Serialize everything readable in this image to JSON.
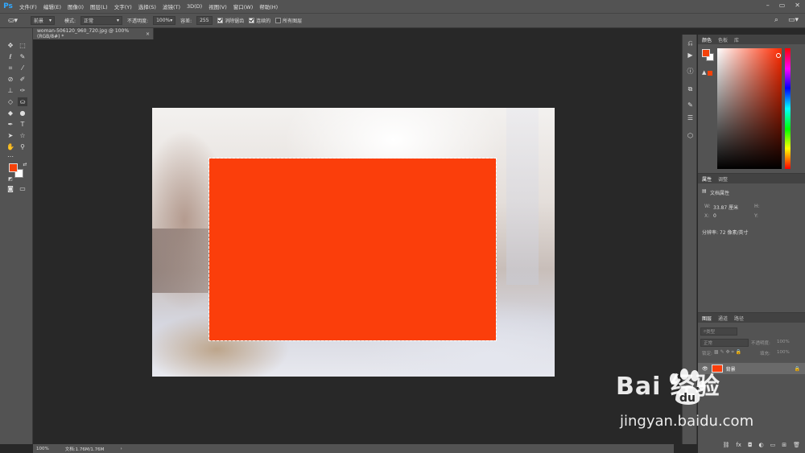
{
  "app": {
    "logo": "Ps"
  },
  "menu": [
    "文件(F)",
    "编辑(E)",
    "图像(I)",
    "图层(L)",
    "文字(Y)",
    "选择(S)",
    "滤镜(T)",
    "3D(D)",
    "视图(V)",
    "窗口(W)",
    "帮助(H)"
  ],
  "options": {
    "preset_label": "前景",
    "mode_label": "模式:",
    "mode_value": "正常",
    "opacity_label": "不透明度:",
    "opacity_value": "100%",
    "tolerance_label": "容差:",
    "tolerance_value": "255",
    "antialias_label": "消除锯齿",
    "contiguous_label": "连续的",
    "all_layers_label": "所有图层"
  },
  "document": {
    "tab_title": "woman-506120_960_720.jpg @ 100%(RGB/8#) *",
    "zoom": "100%",
    "doc_size": "文档:1.76M/1.76M"
  },
  "colors": {
    "foreground": "#f5420a",
    "background": "#ffffff",
    "fill": "#fb3e0b"
  },
  "color_panel": {
    "tabs": [
      "颜色",
      "色板",
      "库"
    ]
  },
  "properties_panel": {
    "tabs": [
      "属性",
      "调整"
    ],
    "header": "文档属性",
    "w_label": "W:",
    "w_value": "33.87 厘米",
    "h_label": "H:",
    "x_label": "X:",
    "x_value": "0",
    "y_label": "Y:",
    "resolution": "分辨率: 72 像素/英寸"
  },
  "layers_panel": {
    "tabs": [
      "图层",
      "通道",
      "路径"
    ],
    "kind_placeholder": "类型",
    "blend_mode": "正常",
    "opacity_label": "不透明度:",
    "opacity_value": "100%",
    "lock_label": "锁定:",
    "fill_label": "填充:",
    "fill_value": "100%",
    "layer_name": "背景"
  },
  "watermark": {
    "logo": "Bai  经验",
    "url": "jingyan.baidu.com"
  }
}
